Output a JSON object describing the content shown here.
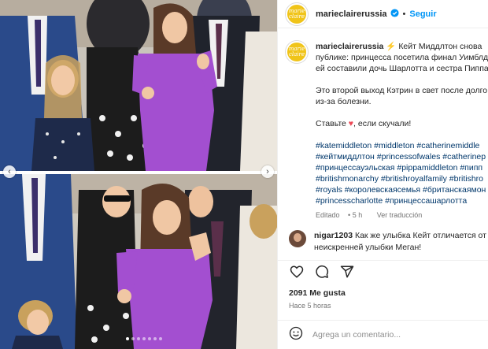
{
  "post": {
    "username": "marieclairerussia",
    "follow_label": "Seguir",
    "separator": "•",
    "avatar_text": [
      "marie",
      "claire"
    ],
    "caption_lines": [
      "⚡ Кейт Миддлтон снова",
      "публике: принцесса посетила финал Уимблд",
      "ей составили дочь Шарлотта и сестра Пиппа"
    ],
    "paragraph_2": [
      "Это второй выход Кэтрин в свет после долго",
      "из-за болезни."
    ],
    "paragraph_3_before": "Ставьте ",
    "paragraph_3_heart": "♥",
    "paragraph_3_after": ", если скучали!",
    "hashtag_lines": [
      "#katemiddleton #middleton #catherinemiddle",
      "#кейтмиддлтон #princessofwales #catherinep",
      "#принцессауэльская #pippamiddleton #пипп",
      "#britishmonarchy #britishroyalfamily #britishro",
      "#royals #королевскаясемья #британскаямон",
      "#princesscharlotte #принцессашарлотта"
    ],
    "edited_label": "Editado",
    "edited_time": "5 h",
    "translation_label": "Ver traducción",
    "comment": {
      "username": "nigar1203",
      "lines": [
        "Как же улыбка Кейт отличается от",
        "неискренней улыбки Меган!"
      ]
    },
    "likes": "2091 Me gusta",
    "time_ago": "Hace 5 horas",
    "comment_placeholder": "Agrega un comentario..."
  },
  "carousel": {
    "slide_count": 7,
    "active_index": 0
  },
  "icons": {
    "like": "heart-icon",
    "comment": "comment-icon",
    "share": "share-icon",
    "emoji": "emoji-icon",
    "verified": "verified-badge-icon",
    "prev": "chevron-left-icon",
    "next": "chevron-right-icon"
  },
  "colors": {
    "accent": "#0095f6",
    "hashtag": "#00376b",
    "muted": "#737373",
    "dress": "#a34fd0",
    "brand_badge": "#f0c419"
  }
}
